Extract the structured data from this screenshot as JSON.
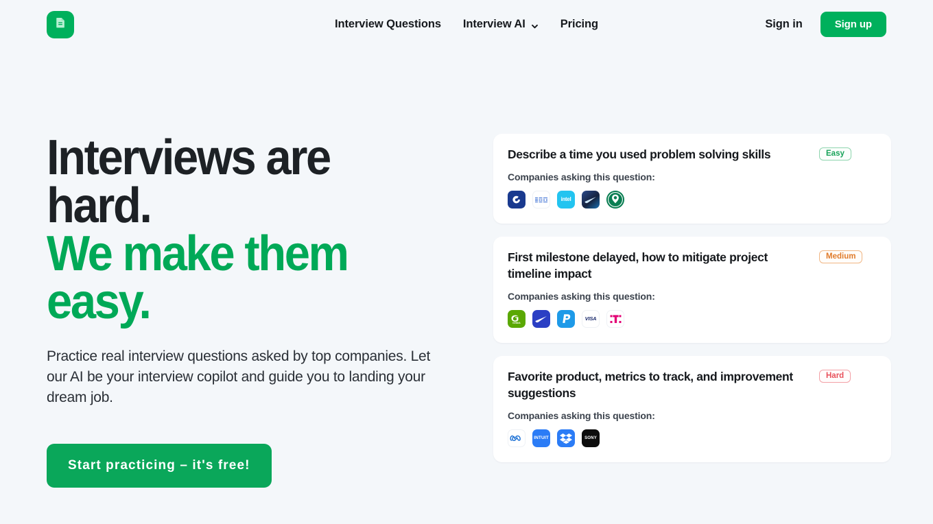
{
  "brand": {
    "logo_icon": "document-logo-icon",
    "logo_color": "#00b05c"
  },
  "header": {
    "nav": [
      {
        "label": "Interview Questions",
        "has_dropdown": false
      },
      {
        "label": "Interview AI",
        "has_dropdown": true,
        "icon": "chevron-down-icon"
      },
      {
        "label": "Pricing",
        "has_dropdown": false
      }
    ],
    "sign_in_label": "Sign in",
    "sign_up_label": "Sign up",
    "sign_up_color": "#00b05c"
  },
  "hero": {
    "headline_line1": "Interviews are hard.",
    "headline_line2": "We make them easy.",
    "headline_accent_color": "#00a957",
    "subtitle": "Practice real interview questions asked by top companies. Let our AI be your interview copilot and guide you to landing your dream job.",
    "cta_label": "Start practicing – it's free!",
    "cta_color": "#0aa75a"
  },
  "cards": {
    "companies_label": "Companies asking this question:",
    "items": [
      {
        "title": "Describe a time you used problem solving skills",
        "difficulty": "Easy",
        "difficulty_level": "easy",
        "difficulty_color": "#19a35a",
        "companies": [
          {
            "name": "Capital One",
            "icon": "capital-one-logo"
          },
          {
            "name": "IBM",
            "icon": "ibm-logo"
          },
          {
            "name": "Intel",
            "icon": "intel-logo"
          },
          {
            "name": "Nike",
            "icon": "nike-logo"
          },
          {
            "name": "Starbucks",
            "icon": "starbucks-logo"
          }
        ]
      },
      {
        "title": "First milestone delayed, how to mitigate project timeline impact",
        "difficulty": "Medium",
        "difficulty_level": "medium",
        "difficulty_color": "#e07b2a",
        "companies": [
          {
            "name": "NVIDIA",
            "icon": "nvidia-logo"
          },
          {
            "name": "Nike",
            "icon": "nike-logo"
          },
          {
            "name": "PayPal",
            "icon": "paypal-logo"
          },
          {
            "name": "Visa",
            "icon": "visa-logo"
          },
          {
            "name": "T-Mobile",
            "icon": "tmobile-logo"
          }
        ]
      },
      {
        "title": "Favorite product, metrics to track, and improvement suggestions",
        "difficulty": "Hard",
        "difficulty_level": "hard",
        "difficulty_color": "#e8505b",
        "companies": [
          {
            "name": "Meta",
            "icon": "meta-logo"
          },
          {
            "name": "Intuit",
            "icon": "intuit-logo"
          },
          {
            "name": "Dropbox",
            "icon": "dropbox-logo"
          },
          {
            "name": "Sony",
            "icon": "sony-logo"
          }
        ]
      }
    ]
  }
}
